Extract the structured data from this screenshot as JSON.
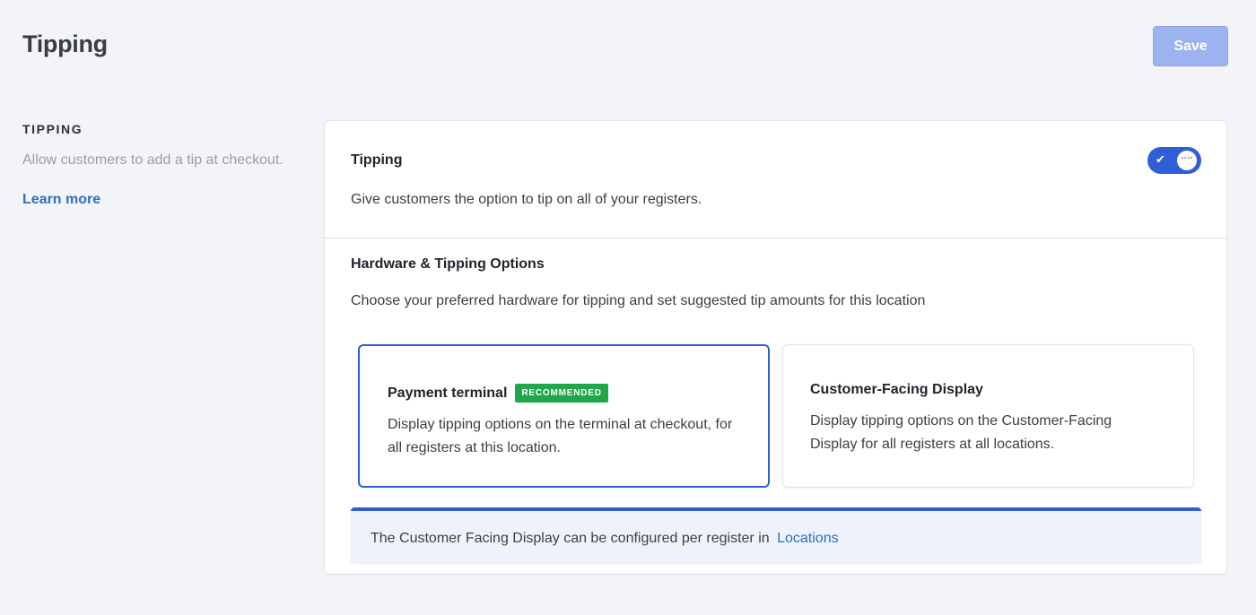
{
  "header": {
    "title": "Tipping",
    "save_label": "Save"
  },
  "sidebar": {
    "section_label": "TIPPING",
    "description": "Allow customers to add a tip at checkout.",
    "learn_more": "Learn more"
  },
  "tipping_row": {
    "title": "Tipping",
    "description": "Give customers the option to tip on all of your registers.",
    "toggle_enabled": true,
    "toggle_icon": "check-icon"
  },
  "hardware": {
    "title": "Hardware & Tipping Options",
    "description": "Choose your preferred hardware for tipping and set suggested tip amounts for this location",
    "options": [
      {
        "title": "Payment terminal",
        "badge": "RECOMMENDED",
        "description": "Display tipping options on the terminal at checkout, for all registers at this location.",
        "selected": true
      },
      {
        "title": "Customer-Facing Display",
        "description": "Display tipping options on the Customer-Facing Display for all registers at all locations.",
        "selected": false
      }
    ]
  },
  "banner": {
    "text": "The Customer Facing Display can be configured per register in",
    "link": "Locations"
  },
  "colors": {
    "accent": "#2f5fd6",
    "save_disabled": "#9db3ef",
    "badge": "#1fa84a",
    "link": "#2b6fc7"
  }
}
